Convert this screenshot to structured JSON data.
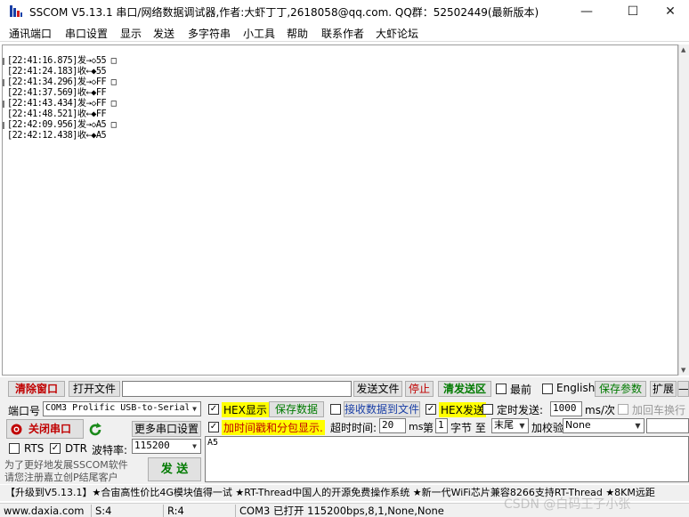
{
  "title": "SSCOM V5.13.1 串口/网络数据调试器,作者:大虾丁丁,2618058@qq.com. QQ群：52502449(最新版本)",
  "window_controls": {
    "minimize": "—",
    "maximize": "☐",
    "close": "✕"
  },
  "menu": [
    "通讯端口",
    "串口设置",
    "显示",
    "发送",
    "多字符串",
    "小工具",
    "帮助",
    "联系作者",
    "大虾论坛"
  ],
  "receive_lines": [
    "[22:41:16.875]发→◇55 □",
    "[22:41:24.183]收←◆55",
    "[22:41:34.296]发→◇FF □",
    "[22:41:37.569]收←◆FF",
    "[22:41:43.434]发→◇FF □",
    "[22:41:48.521]收←◆FF",
    "[22:42:09.956]发→◇A5 □",
    "[22:42:12.438]收←◆A5"
  ],
  "toolbar": {
    "clear_window": "清除窗口",
    "open_file": "打开文件",
    "file_path": "",
    "send_file": "发送文件",
    "stop": "停止",
    "clear_send": "清发送区",
    "topmost": "最前",
    "english": "English",
    "save_params": "保存参数",
    "expand": "扩展",
    "collapse": "—"
  },
  "port": {
    "label": "端口号",
    "value": "COM3 Prolific USB-to-Serial",
    "close_port": "关闭串口",
    "more_settings": "更多串口设置",
    "rts": "RTS",
    "dtr": "DTR",
    "baud_label": "波特率:",
    "baud_value": "115200"
  },
  "options": {
    "hex_display": "HEX显示",
    "save_data": "保存数据",
    "recv_to_file": "接收数据到文件",
    "hex_send": "HEX发送",
    "timed_send": "定时发送:",
    "interval": "1000",
    "interval_unit": "ms/次",
    "add_crlf": "加回车换行",
    "timestamp": "加时间戳和分包显示.",
    "timeout_label": "超时时间:",
    "timeout_value": "20",
    "timeout_unit": "ms",
    "byte_prefix": "第",
    "byte_index": "1",
    "byte_to": "字节 至",
    "byte_end": "末尾",
    "checksum_label": "加校验",
    "checksum_value": "None"
  },
  "send": {
    "text": "A5",
    "button": "发 送",
    "promo_line1": "为了更好地发展SSCOM软件",
    "promo_line2": "请您注册嘉立创P结尾客户"
  },
  "ticker": "【升级到V5.13.1】★合宙高性价比4G模块值得一试 ★RT-Thread中国人的开源免费操作系统 ★新一代WiFi芯片兼容8266支持RT-Thread ★8KM远距",
  "statusbar": {
    "website": "www.daxia.com",
    "sent": "S:4",
    "received": "R:4",
    "port_status": "COM3 已打开  115200bps,8,1,None,None"
  },
  "watermark": "CSDN @白码王子小张"
}
